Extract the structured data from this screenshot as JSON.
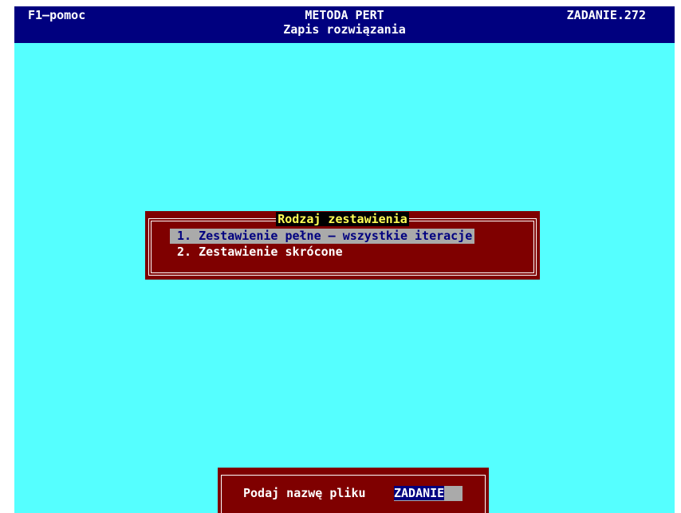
{
  "header": {
    "help": "F1–pomoc",
    "title": "METODA PERT",
    "subtitle": "Zapis rozwiązania",
    "file": "ZADANIE.272"
  },
  "dialog": {
    "title": "Rodzaj zestawienia",
    "items": [
      {
        "label": "1. Zestawienie pełne – wszystkie iteracje",
        "selected": true
      },
      {
        "label": "2. Zestawienie skrócone",
        "selected": false
      }
    ]
  },
  "prompt": {
    "label": "Podaj nazwę pliku",
    "value": "ZADANIE"
  },
  "colors": {
    "header_bg": "#00007f",
    "workspace_bg": "#55ffff",
    "dialog_bg": "#7f0000",
    "highlight_bg": "#aaaaaa",
    "title_text": "#ffff55"
  }
}
